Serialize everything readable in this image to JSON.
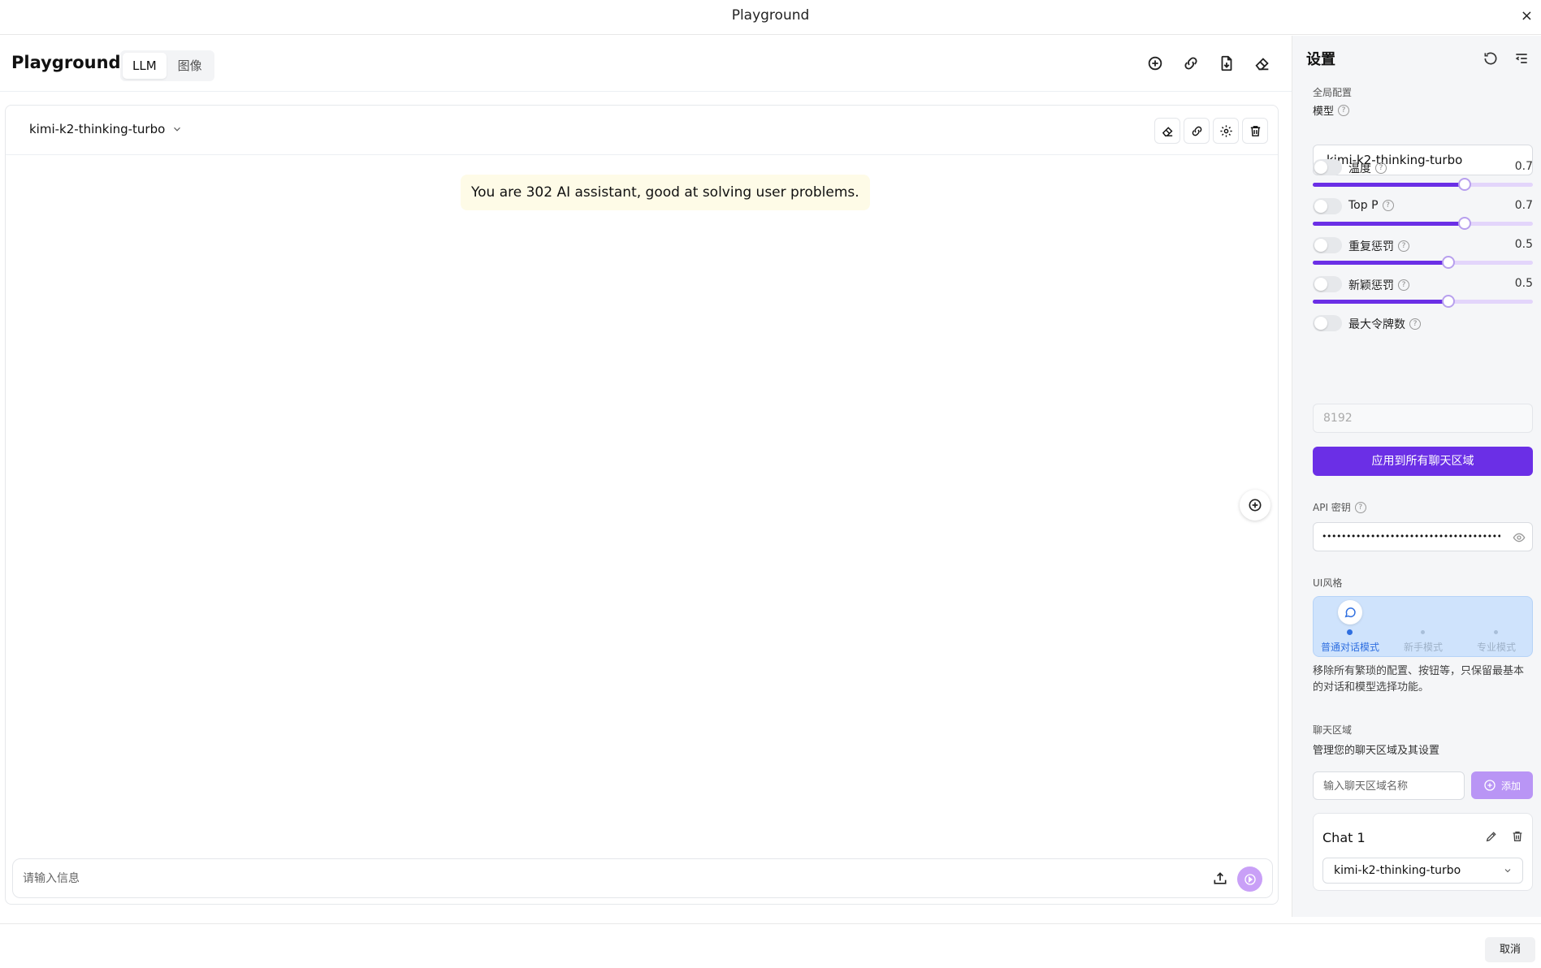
{
  "window": {
    "title": "Playground",
    "close": "×"
  },
  "header": {
    "brand": "Playground",
    "tabs": [
      {
        "label": "LLM",
        "active": true
      },
      {
        "label": "图像",
        "active": false
      }
    ],
    "icons": [
      "add-circle-icon",
      "link-icon",
      "export-file-icon",
      "eraser-icon"
    ]
  },
  "chat": {
    "model": "kimi-k2-thinking-turbo",
    "icons": [
      "eraser-icon",
      "link-icon",
      "gear-icon",
      "trash-icon"
    ],
    "system_message": "You are 302 AI assistant, good at solving user problems.",
    "input_placeholder": "请输入信息"
  },
  "settings": {
    "title": "设置",
    "global_section": "全局配置",
    "model_label": "模型",
    "model_value": "kimi-k2-thinking-turbo",
    "params": [
      {
        "label": "温度",
        "value": "0.7",
        "fraction": 0.69
      },
      {
        "label": "Top P",
        "value": "0.7",
        "fraction": 0.69
      },
      {
        "label": "重复惩罚",
        "value": "0.5",
        "fraction": 0.615
      },
      {
        "label": "新颖惩罚",
        "value": "0.5",
        "fraction": 0.615
      }
    ],
    "max_tokens_label": "最大令牌数",
    "max_tokens_value": "8192",
    "apply_label": "应用到所有聊天区域",
    "api_key_label": "API 密钥",
    "api_key_masked": "••••••••••••••••••••••••••••••••••••••••••",
    "ui_style_label": "UI风格",
    "ui_modes": [
      {
        "label": "普通对话模式",
        "selected": true
      },
      {
        "label": "新手模式",
        "selected": false
      },
      {
        "label": "专业模式",
        "selected": false
      }
    ],
    "ui_description": "移除所有繁琐的配置、按钮等，只保留最基本的对话和模型选择功能。",
    "chat_area_label": "聊天区域",
    "chat_area_desc": "管理您的聊天区域及其设置",
    "chat_name_placeholder": "输入聊天区域名称",
    "add_label": "添加",
    "chats": [
      {
        "name": "Chat 1",
        "model": "kimi-k2-thinking-turbo"
      }
    ]
  },
  "footer": {
    "cancel_label": "取消"
  },
  "colors": {
    "accent": "#6b2fe6",
    "system_bg": "#fefbe7",
    "ui_mode_bg": "#cfe3fc"
  }
}
